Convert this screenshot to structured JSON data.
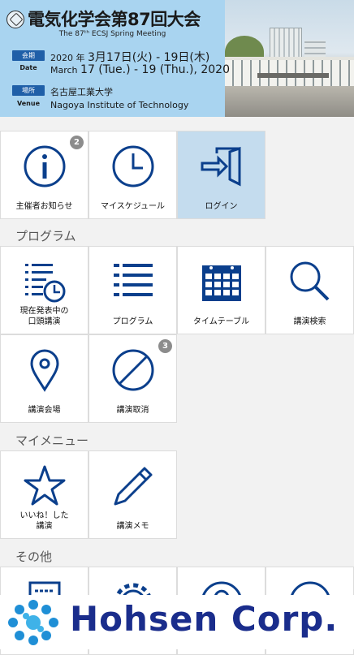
{
  "header": {
    "title": "電気化学会第87回大会",
    "subtitle": "The 87ᵗʰ ECSJ Spring Meeting",
    "period_label_ja": "会期",
    "period_label_en": "Date",
    "period_ja_prefix": "2020 年 ",
    "period_ja_main": "3月17日(火) - 19日(木)",
    "period_en_prefix": "March ",
    "period_en_main": "17 (Tue.) - 19 (Thu.), 2020",
    "venue_label_ja": "場所",
    "venue_label_en": "Venue",
    "venue_ja": "名古屋工業大学",
    "venue_en": "Nagoya Institute of Technology"
  },
  "top_tiles": [
    {
      "label": "主催者お知らせ",
      "icon": "info-icon",
      "badge": "2"
    },
    {
      "label": "マイスケジュール",
      "icon": "clock-icon"
    },
    {
      "label": "ログイン",
      "icon": "login-icon"
    }
  ],
  "sections": {
    "program": "プログラム",
    "my_menu": "マイメニュー",
    "other": "その他"
  },
  "program_tiles": [
    {
      "label": "現在発表中の\n口頭講演",
      "icon": "list-clock-icon"
    },
    {
      "label": "プログラム",
      "icon": "list-icon"
    },
    {
      "label": "タイムテーブル",
      "icon": "calendar-icon"
    },
    {
      "label": "講演検索",
      "icon": "search-icon"
    },
    {
      "label": "講演会場",
      "icon": "location-pin-icon"
    },
    {
      "label": "講演取消",
      "icon": "cancel-icon",
      "badge": "3"
    }
  ],
  "mymenu_tiles": [
    {
      "label": "いいね！した\n講演",
      "icon": "star-icon"
    },
    {
      "label": "講演メモ",
      "icon": "pencil-icon"
    }
  ],
  "other_tiles": [
    {
      "icon": "document-icon"
    },
    {
      "icon": "gear-icon"
    },
    {
      "icon": "question-icon"
    },
    {
      "icon": "check-icon"
    }
  ],
  "ad": {
    "company": "Hohsen Corp."
  },
  "colors": {
    "accent": "#0b3f8c",
    "banner": "#a9d4f0",
    "active_tile": "#c4dcee"
  }
}
